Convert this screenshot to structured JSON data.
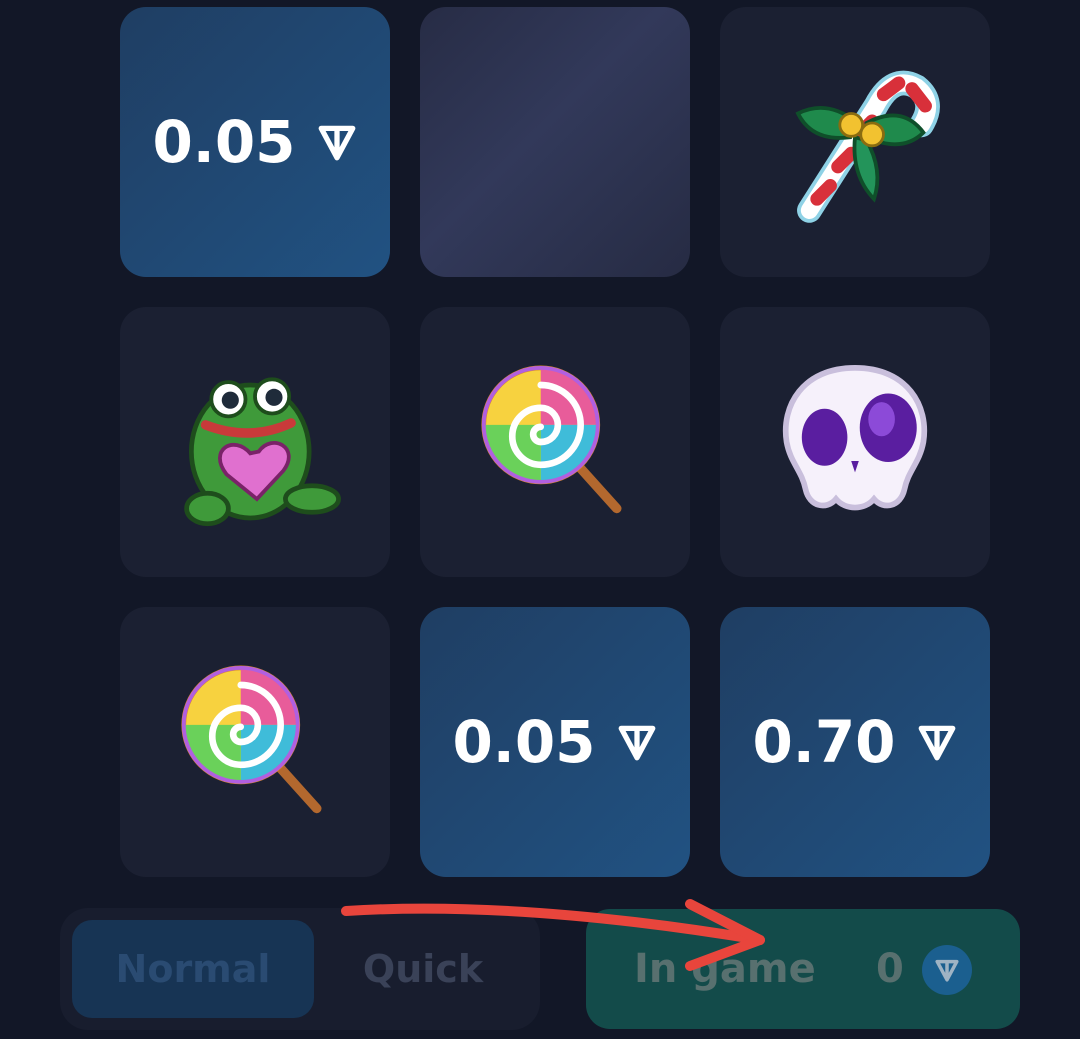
{
  "board": {
    "tiles": [
      {
        "kind": "value",
        "value": "0.05"
      },
      {
        "kind": "pending"
      },
      {
        "kind": "sticker",
        "icon": "candy-cane-icon"
      },
      {
        "kind": "sticker",
        "icon": "frog-heart-icon"
      },
      {
        "kind": "sticker",
        "icon": "lollipop-icon"
      },
      {
        "kind": "sticker",
        "icon": "skull-icon"
      },
      {
        "kind": "sticker",
        "icon": "lollipop-icon"
      },
      {
        "kind": "value",
        "value": "0.05"
      },
      {
        "kind": "value",
        "value": "0.70"
      }
    ]
  },
  "modes": {
    "normal_label": "Normal",
    "quick_label": "Quick",
    "selected": "Normal"
  },
  "status": {
    "label": "In game",
    "count": "0",
    "currency_icon": "ton-icon"
  },
  "colors": {
    "background": "#121727",
    "tile": "#1b2032",
    "value_tile": "#215282",
    "in_game": "#134b4a",
    "annotation_arrow": "#e8453c"
  }
}
